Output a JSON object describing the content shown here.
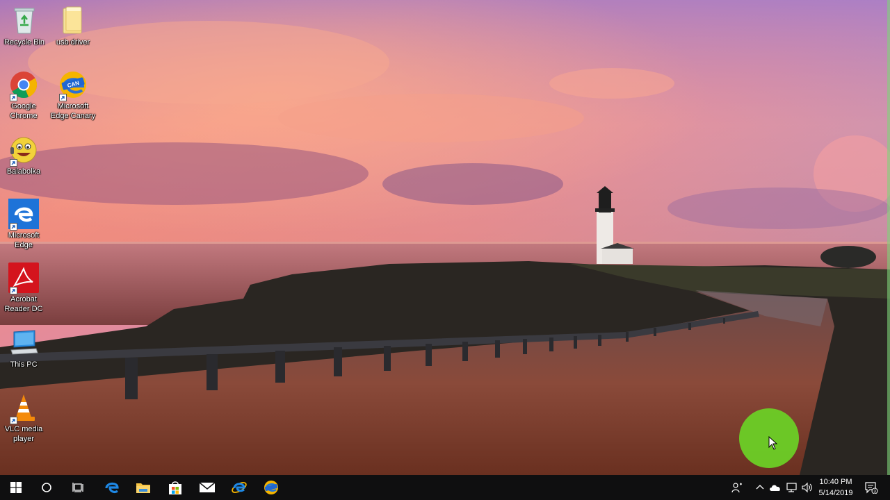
{
  "desktop": {
    "wallpaper": "Lighthouse by the sea at sunset",
    "icons": [
      {
        "label": "Recycle Bin",
        "icon": "recycle-bin-icon",
        "shortcut": false
      },
      {
        "label": "usb driver",
        "icon": "folder-icon",
        "shortcut": false
      },
      {
        "label": "Google\nChrome",
        "icon": "chrome-icon",
        "shortcut": true
      },
      {
        "label": "Microsoft\nEdge Canary",
        "icon": "edge-canary-icon",
        "shortcut": true
      },
      {
        "label": "Balabolka",
        "icon": "balabolka-icon",
        "shortcut": true
      },
      {
        "label": "Microsoft\nEdge",
        "icon": "edge-icon",
        "shortcut": true
      },
      {
        "label": "Acrobat\nReader DC",
        "icon": "acrobat-icon",
        "shortcut": true
      },
      {
        "label": "This PC",
        "icon": "this-pc-icon",
        "shortcut": false
      },
      {
        "label": "VLC media\nplayer",
        "icon": "vlc-icon",
        "shortcut": true
      }
    ]
  },
  "taskbar": {
    "pinned": [
      {
        "name": "start",
        "icon": "windows-logo-icon"
      },
      {
        "name": "search",
        "icon": "cortana-search-icon"
      },
      {
        "name": "task-view",
        "icon": "task-view-icon"
      },
      {
        "name": "edge",
        "icon": "edge-icon"
      },
      {
        "name": "file-explorer",
        "icon": "file-explorer-icon"
      },
      {
        "name": "store",
        "icon": "store-icon"
      },
      {
        "name": "mail",
        "icon": "mail-icon"
      },
      {
        "name": "internet-explorer",
        "icon": "internet-explorer-icon"
      },
      {
        "name": "edge-canary",
        "icon": "edge-canary-icon"
      }
    ],
    "tray": {
      "time": "10:40 PM",
      "date": "5/14/2019",
      "notification_count": "3"
    }
  },
  "colors": {
    "taskbar_bg": "#0f0f10",
    "accent_blue": "#1e73d8",
    "click_indicator": "#6bcf26"
  }
}
